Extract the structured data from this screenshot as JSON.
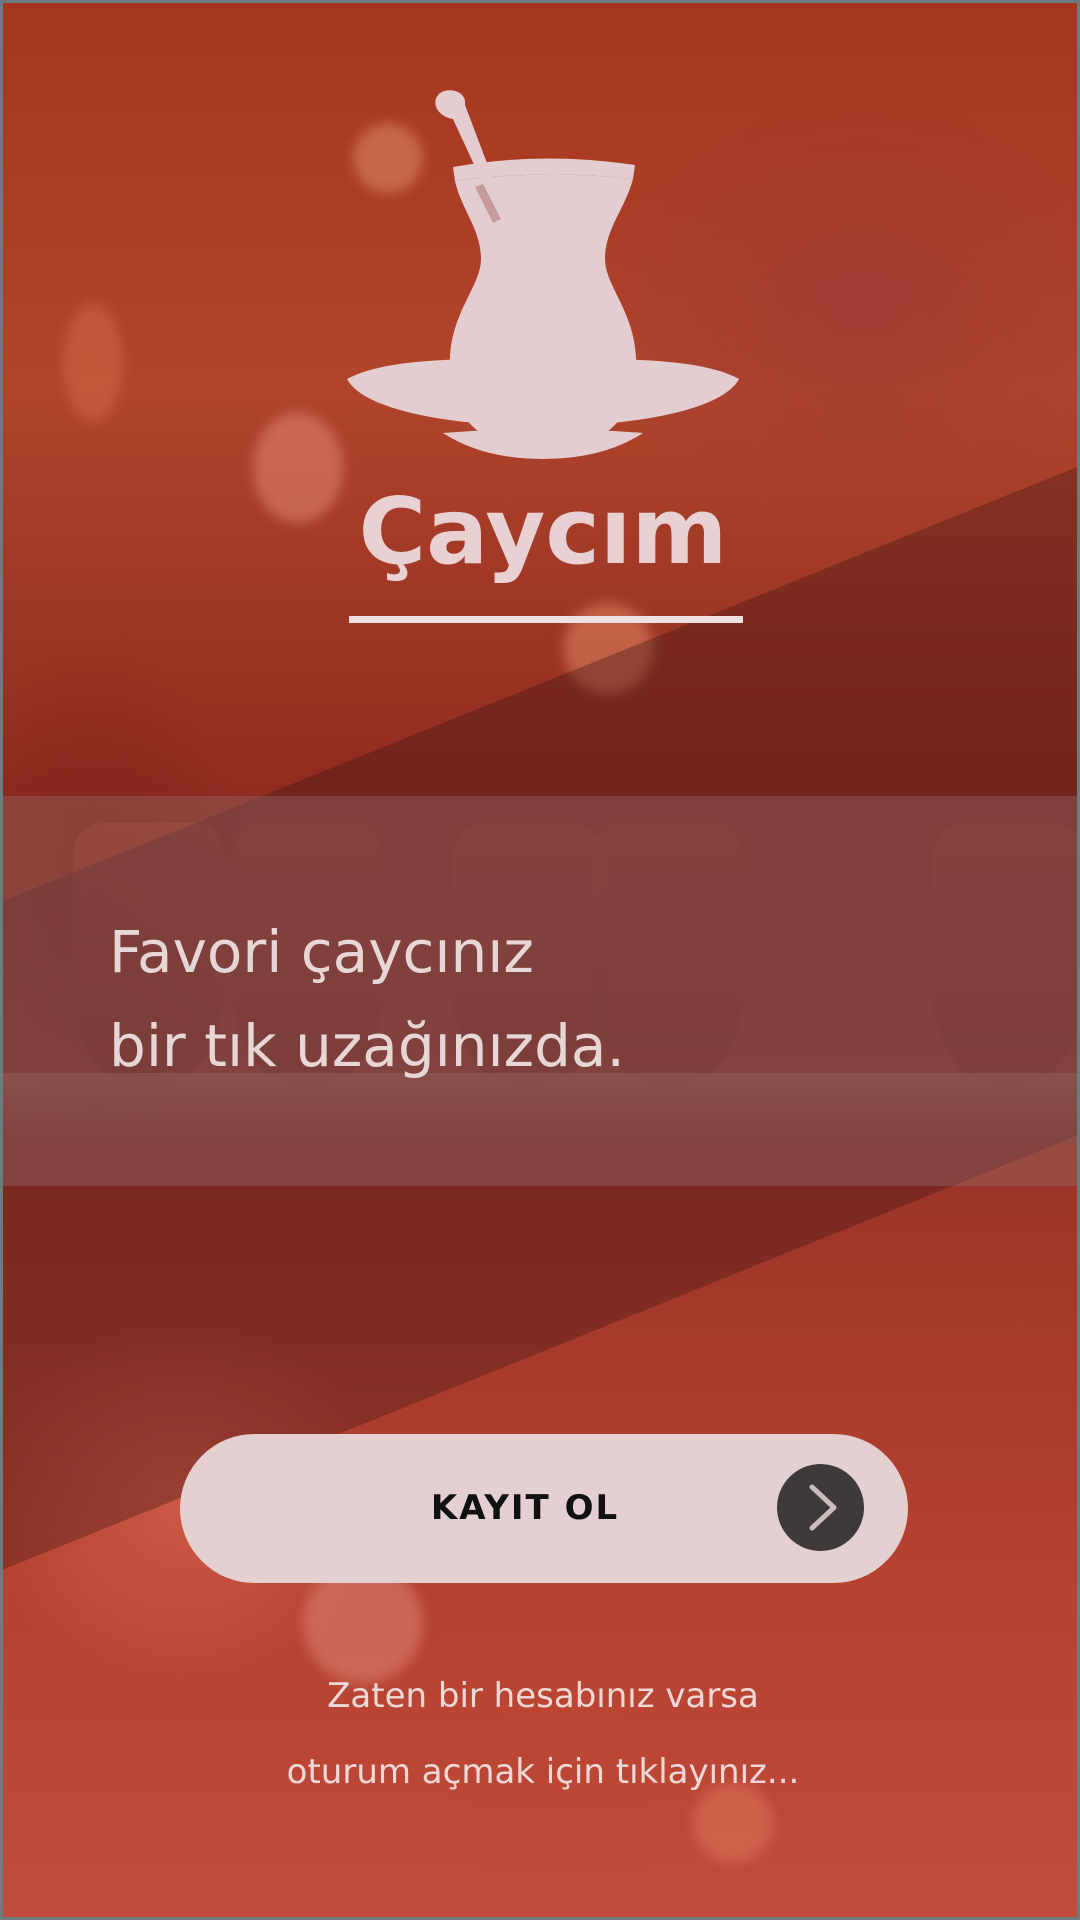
{
  "app": {
    "title": "Çaycım"
  },
  "tagline": {
    "line1": "Favori çaycınız",
    "line2": "bir tık uzağınızda."
  },
  "signup": {
    "label": "KAYIT OL"
  },
  "login": {
    "line1": "Zaten bir hesabınız varsa",
    "line2": "oturum açmak için tıklayınız..."
  },
  "colors": {
    "accent": "#e5d0d1",
    "arrow_button": "#3e3a3a",
    "background": "#a6351f"
  },
  "icons": {
    "logo": "tea-glass-icon",
    "signup_arrow": "chevron-right-icon"
  }
}
